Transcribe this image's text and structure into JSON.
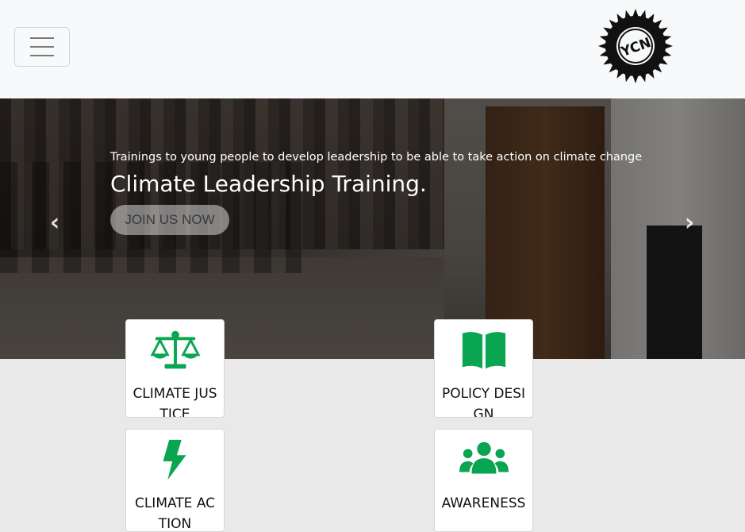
{
  "navbar": {
    "toggle_icon": "hamburger-icon",
    "logo_text": "YCN",
    "logo_icon": "sun-emblem-logo"
  },
  "hero": {
    "subtitle": "Trainings to young people to develop leadership to be able to take action on climate change",
    "title": "Climate Leadership Training.",
    "button_label": "JOIN US NOW",
    "prev_icon": "chevron-left-icon",
    "next_icon": "chevron-right-icon",
    "prev_glyph": "‹",
    "next_glyph": "›"
  },
  "cards": [
    {
      "label": "CLIMATE JUSTICE",
      "icon": "scale-icon"
    },
    {
      "label": "POLICY DESIGN",
      "icon": "book-icon"
    },
    {
      "label": "CLIMATE ACTION",
      "icon": "lightning-bolt-icon"
    },
    {
      "label": "AWARENESS",
      "icon": "users-group-icon"
    }
  ],
  "colors": {
    "accent_green": "#0aa550",
    "navbar_bg": "#f8f9fa",
    "section_bg": "#e9e9e9"
  }
}
